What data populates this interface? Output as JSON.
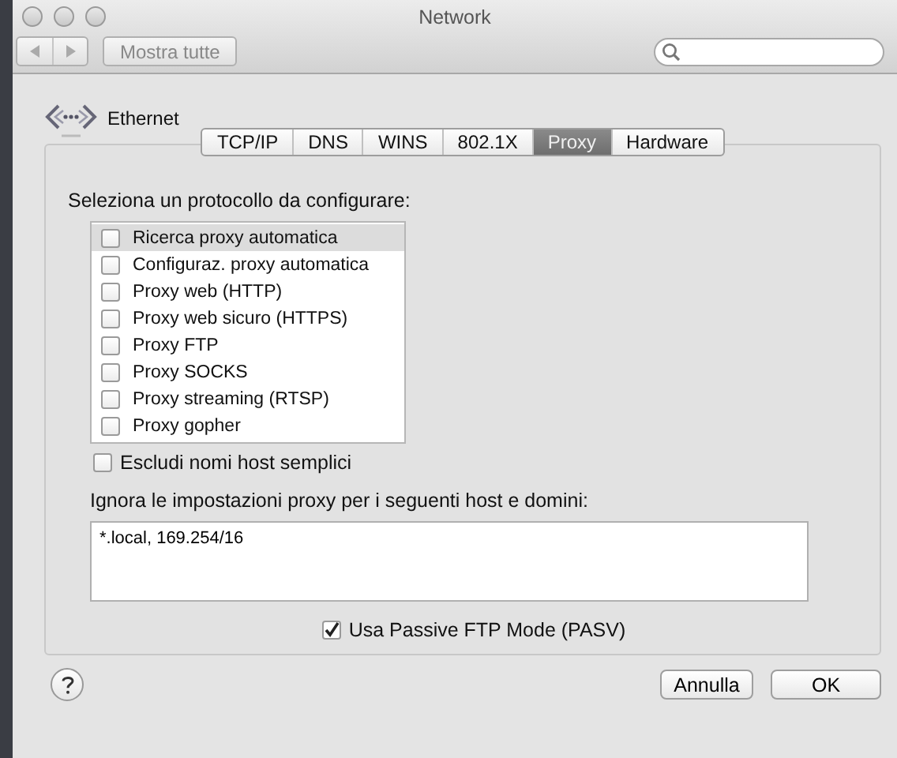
{
  "window": {
    "title": "Network"
  },
  "toolbar": {
    "show_all": "Mostra tutte"
  },
  "service": {
    "name": "Ethernet"
  },
  "tabs": [
    {
      "label": "TCP/IP",
      "selected": false
    },
    {
      "label": "DNS",
      "selected": false
    },
    {
      "label": "WINS",
      "selected": false
    },
    {
      "label": "802.1X",
      "selected": false
    },
    {
      "label": "Proxy",
      "selected": true
    },
    {
      "label": "Hardware",
      "selected": false
    }
  ],
  "protocols": {
    "label": "Seleziona un protocollo da configurare:",
    "items": [
      {
        "label": "Ricerca proxy automatica",
        "checked": false,
        "selected": true
      },
      {
        "label": "Configuraz. proxy automatica",
        "checked": false,
        "selected": false
      },
      {
        "label": "Proxy web (HTTP)",
        "checked": false,
        "selected": false
      },
      {
        "label": "Proxy web sicuro (HTTPS)",
        "checked": false,
        "selected": false
      },
      {
        "label": "Proxy FTP",
        "checked": false,
        "selected": false
      },
      {
        "label": "Proxy SOCKS",
        "checked": false,
        "selected": false
      },
      {
        "label": "Proxy streaming (RTSP)",
        "checked": false,
        "selected": false
      },
      {
        "label": "Proxy gopher",
        "checked": false,
        "selected": false
      }
    ]
  },
  "exclude_simple": {
    "label": "Escludi nomi host semplici",
    "checked": false
  },
  "bypass": {
    "label": "Ignora le impostazioni proxy per i seguenti host e domini:",
    "value": "*.local, 169.254/16"
  },
  "passive_ftp": {
    "label": "Usa Passive FTP Mode (PASV)",
    "checked": true
  },
  "buttons": [
    {
      "label": "Annulla",
      "default": false
    },
    {
      "label": "OK",
      "default": false
    }
  ]
}
